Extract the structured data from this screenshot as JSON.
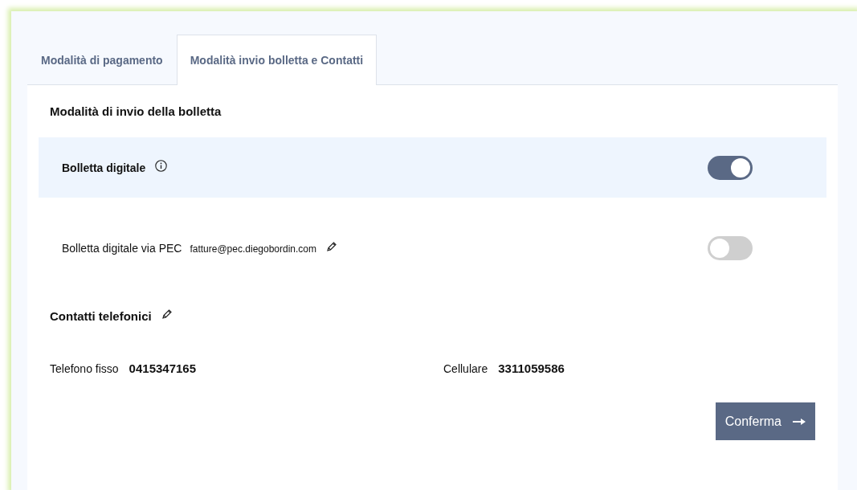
{
  "tabs": [
    {
      "label": "Modalità di pagamento",
      "selected": false
    },
    {
      "label": "Modalità invio bolletta e Contatti",
      "selected": true
    }
  ],
  "billing": {
    "title": "Modalità di invio della bolletta",
    "options": [
      {
        "label": "Bolletta digitale",
        "on": true,
        "highlighted": true,
        "info": true
      },
      {
        "label": "Bolletta digitale via PEC",
        "email": "fatture@pec.diegobordin.com",
        "on": false,
        "highlighted": false,
        "info": false
      }
    ]
  },
  "contacts": {
    "title": "Contatti telefonici",
    "phones": [
      {
        "label": "Telefono fisso",
        "value": "0415347165"
      },
      {
        "label": "Cellulare",
        "value": "3311059586"
      }
    ]
  },
  "confirm_button": "Conferma"
}
